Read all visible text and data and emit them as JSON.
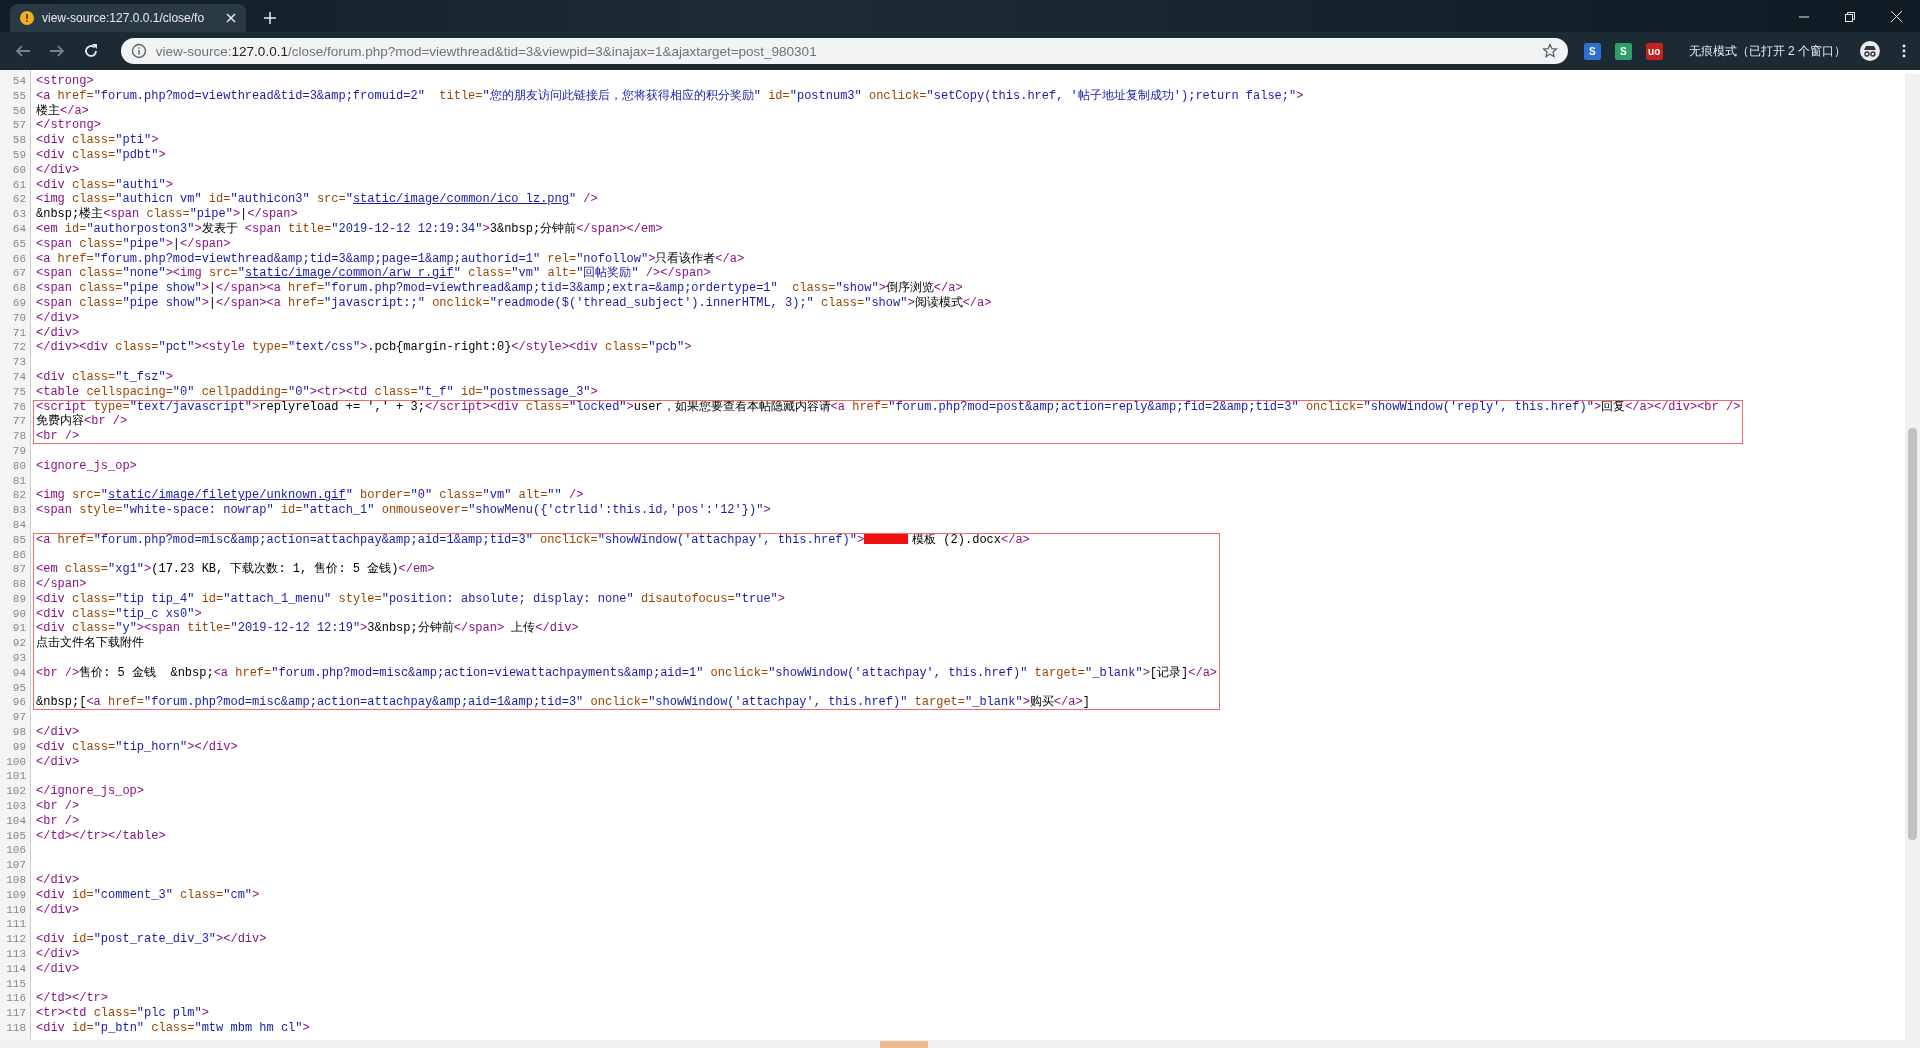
{
  "tab": {
    "title": "view-source:127.0.0.1/close/fo",
    "selected": true
  },
  "address_bar": {
    "scheme": "view-source:",
    "host": "127.0.0.1",
    "path": "/close/forum.php?mod=viewthread&tid=3&viewpid=3&inajax=1&ajaxtarget=post_980301"
  },
  "extension_icons": [
    {
      "label": "S",
      "color": "#2f6fd0"
    },
    {
      "label": "S",
      "color": "#2e9e6a"
    },
    {
      "label": "uo",
      "color": "#c5221f"
    }
  ],
  "incognito_label": "无痕模式（已打开 2 个窗口）",
  "blocks": [
    {
      "highlighted": false,
      "lines": [
        {
          "number": "54",
          "text": "<strong>"
        },
        {
          "number": "55",
          "text": "<a href=\"forum.php?mod=viewthread&tid=3&amp;fromuid=2\"  title=\"您的朋友访问此链接后，您将获得相应的积分奖励\" id=\"postnum3\" onclick=\"setCopy(this.href, '帖子地址复制成功');return false;\">"
        },
        {
          "number": "56",
          "text": "楼主</a>"
        },
        {
          "number": "57",
          "text": "</strong>"
        },
        {
          "number": "58",
          "text": "<div class=\"pti\">"
        },
        {
          "number": "59",
          "text": "<div class=\"pdbt\">"
        },
        {
          "number": "60",
          "text": "</div>"
        },
        {
          "number": "61",
          "text": "<div class=\"authi\">"
        },
        {
          "number": "62",
          "segments": [
            {
              "kind": "code",
              "text": "<img class=\"authicn vm\" id=\"authicon3\" src=\""
            },
            {
              "kind": "link",
              "text": "static/image/common/ico_lz.png"
            },
            {
              "kind": "code",
              "text": "\" />"
            }
          ]
        },
        {
          "number": "63",
          "text": "&nbsp;楼主<span class=\"pipe\">|</span>"
        },
        {
          "number": "64",
          "text": "<em id=\"authorposton3\">发表于 <span title=\"2019-12-12 12:19:34\">3&nbsp;分钟前</span></em>"
        },
        {
          "number": "65",
          "text": "<span class=\"pipe\">|</span>"
        },
        {
          "number": "66",
          "text": "<a href=\"forum.php?mod=viewthread&amp;tid=3&amp;page=1&amp;authorid=1\" rel=\"nofollow\">只看该作者</a>"
        },
        {
          "number": "67",
          "segments": [
            {
              "kind": "code",
              "text": "<span class=\"none\"><img src=\""
            },
            {
              "kind": "link",
              "text": "static/image/common/arw_r.gif"
            },
            {
              "kind": "code",
              "text": "\" class=\"vm\" alt=\"回帖奖励\" /></span>"
            }
          ]
        },
        {
          "number": "68",
          "text": "<span class=\"pipe show\">|</span><a href=\"forum.php?mod=viewthread&amp;tid=3&amp;extra=&amp;ordertype=1\"  class=\"show\">倒序浏览</a>"
        },
        {
          "number": "69",
          "text": "<span class=\"pipe show\">|</span><a href=\"javascript:;\" onclick=\"readmode($('thread_subject').innerHTML, 3);\" class=\"show\">阅读模式</a>"
        },
        {
          "number": "70",
          "text": "</div>"
        },
        {
          "number": "71",
          "text": "</div>"
        },
        {
          "number": "72",
          "text": "</div><div class=\"pct\"><style type=\"text/css\">.pcb{margin-right:0}</style><div class=\"pcb\">"
        },
        {
          "number": "73"
        },
        {
          "number": "74",
          "text": "<div class=\"t_fsz\">"
        },
        {
          "number": "75",
          "text": "<table cellspacing=\"0\" cellpadding=\"0\"><tr><td class=\"t_f\" id=\"postmessage_3\">"
        }
      ]
    },
    {
      "highlighted": true,
      "lines": [
        {
          "number": "76",
          "text": "<script type=\"text/javascript\">replyreload += ',' + 3;</script><div class=\"locked\">user，如果您要查看本帖隐藏内容请<a href=\"forum.php?mod=post&amp;action=reply&amp;fid=2&amp;tid=3\" onclick=\"showWindow('reply', this.href)\">回复</a></div><br />"
        },
        {
          "number": "77",
          "text": "免费内容<br />"
        },
        {
          "number": "78",
          "text": "<br />"
        }
      ]
    },
    {
      "highlighted": false,
      "lines": [
        {
          "number": "79"
        },
        {
          "number": "80",
          "text": "<ignore_js_op>"
        },
        {
          "number": "81"
        },
        {
          "number": "82",
          "segments": [
            {
              "kind": "code",
              "text": "<img src=\""
            },
            {
              "kind": "link",
              "text": "static/image/filetype/unknown.gif"
            },
            {
              "kind": "code",
              "text": "\" border=\"0\" class=\"vm\" alt=\"\" />"
            }
          ]
        },
        {
          "number": "83",
          "text": "<span style=\"white-space: nowrap\" id=\"attach_1\" onmouseover=\"showMenu({'ctrlid':this.id,'pos':'12'})\">"
        },
        {
          "number": "84"
        }
      ]
    },
    {
      "highlighted": true,
      "lines": [
        {
          "number": "85",
          "segments": [
            {
              "kind": "code",
              "text": "<a href=\"forum.php?mod=misc&amp;action=attachpay&amp;aid=1&amp;tid=3\" onclick=\"showWindow('attachpay', this.href)\">"
            },
            {
              "kind": "redacted"
            },
            {
              "kind": "code",
              "text": "模板 (2).docx</a>"
            }
          ]
        },
        {
          "number": "86"
        },
        {
          "number": "87",
          "text": "<em class=\"xg1\">(17.23 KB, 下载次数: 1, 售价: 5 金钱)</em>"
        },
        {
          "number": "88",
          "text": "</span>"
        },
        {
          "number": "89",
          "text": "<div class=\"tip tip_4\" id=\"attach_1_menu\" style=\"position: absolute; display: none\" disautofocus=\"true\">"
        },
        {
          "number": "90",
          "text": "<div class=\"tip_c xs0\">"
        },
        {
          "number": "91",
          "text": "<div class=\"y\"><span title=\"2019-12-12 12:19\">3&nbsp;分钟前</span> 上传</div>"
        },
        {
          "number": "92",
          "text": "点击文件名下载附件"
        },
        {
          "number": "93"
        },
        {
          "number": "94",
          "text": "<br />售价: 5 金钱  &nbsp;<a href=\"forum.php?mod=misc&amp;action=viewattachpayments&amp;aid=1\" onclick=\"showWindow('attachpay', this.href)\" target=\"_blank\">[记录]</a>"
        },
        {
          "number": "95"
        },
        {
          "number": "96",
          "text": "&nbsp;[<a href=\"forum.php?mod=misc&amp;action=attachpay&amp;aid=1&amp;tid=3\" onclick=\"showWindow('attachpay', this.href)\" target=\"_blank\">购买</a>]"
        }
      ]
    },
    {
      "highlighted": false,
      "lines": [
        {
          "number": "97"
        },
        {
          "number": "98",
          "text": "</div>"
        },
        {
          "number": "99",
          "text": "<div class=\"tip_horn\"></div>"
        },
        {
          "number": "100",
          "text": "</div>"
        },
        {
          "number": "101"
        },
        {
          "number": "102",
          "text": "</ignore_js_op>"
        },
        {
          "number": "103",
          "text": "<br />"
        },
        {
          "number": "104",
          "text": "<br />"
        },
        {
          "number": "105",
          "text": "</td></tr></table>"
        },
        {
          "number": "106"
        },
        {
          "number": "107"
        },
        {
          "number": "108",
          "text": "</div>"
        },
        {
          "number": "109",
          "text": "<div id=\"comment_3\" class=\"cm\">"
        },
        {
          "number": "110",
          "text": "</div>"
        },
        {
          "number": "111"
        },
        {
          "number": "112",
          "text": "<div id=\"post_rate_div_3\"></div>"
        },
        {
          "number": "113",
          "text": "</div>"
        },
        {
          "number": "114",
          "text": "</div>"
        },
        {
          "number": "115"
        },
        {
          "number": "116",
          "text": "</td></tr>"
        },
        {
          "number": "117",
          "text": "<tr><td class=\"plc plm\">"
        },
        {
          "number": "118",
          "text": "<div id=\"p_btn\" class=\"mtw mbm hm cl\">"
        }
      ]
    }
  ]
}
